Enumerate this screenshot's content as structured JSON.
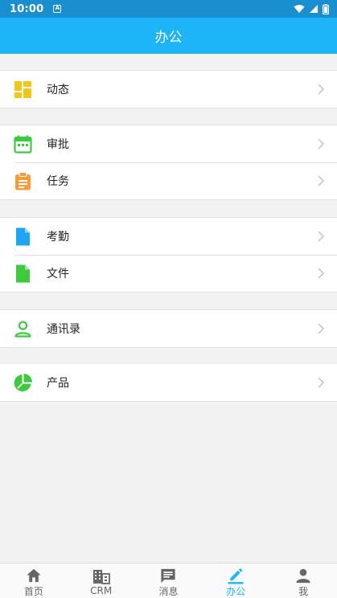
{
  "status": {
    "time": "10:00",
    "notif": "A"
  },
  "header": {
    "title": "办公"
  },
  "menu": {
    "dynamics": "动态",
    "approval": "审批",
    "tasks": "任务",
    "attendance": "考勤",
    "files": "文件",
    "contacts": "通讯录",
    "products": "产品"
  },
  "tabs": [
    {
      "label": "首页",
      "icon": "home-icon"
    },
    {
      "label": "CRM",
      "icon": "building-icon"
    },
    {
      "label": "消息",
      "icon": "message-icon"
    },
    {
      "label": "办公",
      "icon": "pencil-icon",
      "active": true
    },
    {
      "label": "我",
      "icon": "person-icon"
    }
  ],
  "colors": {
    "statusbar": "#1a8fd0",
    "appbar": "#1eb4f8",
    "active_tab": "#1eb4f8",
    "yellow": "#f3c613",
    "green": "#3ec93e",
    "orange": "#f29c3b",
    "blue": "#1ea6f0"
  }
}
